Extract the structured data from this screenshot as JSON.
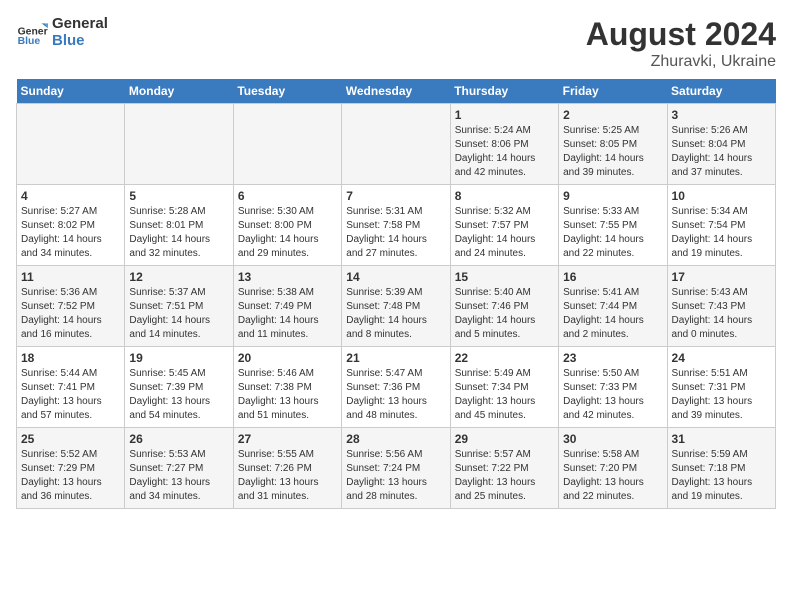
{
  "logo": {
    "general": "General",
    "blue": "Blue"
  },
  "title": "August 2024",
  "subtitle": "Zhuravki, Ukraine",
  "weekdays": [
    "Sunday",
    "Monday",
    "Tuesday",
    "Wednesday",
    "Thursday",
    "Friday",
    "Saturday"
  ],
  "weeks": [
    [
      {
        "day": "",
        "info": ""
      },
      {
        "day": "",
        "info": ""
      },
      {
        "day": "",
        "info": ""
      },
      {
        "day": "",
        "info": ""
      },
      {
        "day": "1",
        "info": "Sunrise: 5:24 AM\nSunset: 8:06 PM\nDaylight: 14 hours\nand 42 minutes."
      },
      {
        "day": "2",
        "info": "Sunrise: 5:25 AM\nSunset: 8:05 PM\nDaylight: 14 hours\nand 39 minutes."
      },
      {
        "day": "3",
        "info": "Sunrise: 5:26 AM\nSunset: 8:04 PM\nDaylight: 14 hours\nand 37 minutes."
      }
    ],
    [
      {
        "day": "4",
        "info": "Sunrise: 5:27 AM\nSunset: 8:02 PM\nDaylight: 14 hours\nand 34 minutes."
      },
      {
        "day": "5",
        "info": "Sunrise: 5:28 AM\nSunset: 8:01 PM\nDaylight: 14 hours\nand 32 minutes."
      },
      {
        "day": "6",
        "info": "Sunrise: 5:30 AM\nSunset: 8:00 PM\nDaylight: 14 hours\nand 29 minutes."
      },
      {
        "day": "7",
        "info": "Sunrise: 5:31 AM\nSunset: 7:58 PM\nDaylight: 14 hours\nand 27 minutes."
      },
      {
        "day": "8",
        "info": "Sunrise: 5:32 AM\nSunset: 7:57 PM\nDaylight: 14 hours\nand 24 minutes."
      },
      {
        "day": "9",
        "info": "Sunrise: 5:33 AM\nSunset: 7:55 PM\nDaylight: 14 hours\nand 22 minutes."
      },
      {
        "day": "10",
        "info": "Sunrise: 5:34 AM\nSunset: 7:54 PM\nDaylight: 14 hours\nand 19 minutes."
      }
    ],
    [
      {
        "day": "11",
        "info": "Sunrise: 5:36 AM\nSunset: 7:52 PM\nDaylight: 14 hours\nand 16 minutes."
      },
      {
        "day": "12",
        "info": "Sunrise: 5:37 AM\nSunset: 7:51 PM\nDaylight: 14 hours\nand 14 minutes."
      },
      {
        "day": "13",
        "info": "Sunrise: 5:38 AM\nSunset: 7:49 PM\nDaylight: 14 hours\nand 11 minutes."
      },
      {
        "day": "14",
        "info": "Sunrise: 5:39 AM\nSunset: 7:48 PM\nDaylight: 14 hours\nand 8 minutes."
      },
      {
        "day": "15",
        "info": "Sunrise: 5:40 AM\nSunset: 7:46 PM\nDaylight: 14 hours\nand 5 minutes."
      },
      {
        "day": "16",
        "info": "Sunrise: 5:41 AM\nSunset: 7:44 PM\nDaylight: 14 hours\nand 2 minutes."
      },
      {
        "day": "17",
        "info": "Sunrise: 5:43 AM\nSunset: 7:43 PM\nDaylight: 14 hours\nand 0 minutes."
      }
    ],
    [
      {
        "day": "18",
        "info": "Sunrise: 5:44 AM\nSunset: 7:41 PM\nDaylight: 13 hours\nand 57 minutes."
      },
      {
        "day": "19",
        "info": "Sunrise: 5:45 AM\nSunset: 7:39 PM\nDaylight: 13 hours\nand 54 minutes."
      },
      {
        "day": "20",
        "info": "Sunrise: 5:46 AM\nSunset: 7:38 PM\nDaylight: 13 hours\nand 51 minutes."
      },
      {
        "day": "21",
        "info": "Sunrise: 5:47 AM\nSunset: 7:36 PM\nDaylight: 13 hours\nand 48 minutes."
      },
      {
        "day": "22",
        "info": "Sunrise: 5:49 AM\nSunset: 7:34 PM\nDaylight: 13 hours\nand 45 minutes."
      },
      {
        "day": "23",
        "info": "Sunrise: 5:50 AM\nSunset: 7:33 PM\nDaylight: 13 hours\nand 42 minutes."
      },
      {
        "day": "24",
        "info": "Sunrise: 5:51 AM\nSunset: 7:31 PM\nDaylight: 13 hours\nand 39 minutes."
      }
    ],
    [
      {
        "day": "25",
        "info": "Sunrise: 5:52 AM\nSunset: 7:29 PM\nDaylight: 13 hours\nand 36 minutes."
      },
      {
        "day": "26",
        "info": "Sunrise: 5:53 AM\nSunset: 7:27 PM\nDaylight: 13 hours\nand 34 minutes."
      },
      {
        "day": "27",
        "info": "Sunrise: 5:55 AM\nSunset: 7:26 PM\nDaylight: 13 hours\nand 31 minutes."
      },
      {
        "day": "28",
        "info": "Sunrise: 5:56 AM\nSunset: 7:24 PM\nDaylight: 13 hours\nand 28 minutes."
      },
      {
        "day": "29",
        "info": "Sunrise: 5:57 AM\nSunset: 7:22 PM\nDaylight: 13 hours\nand 25 minutes."
      },
      {
        "day": "30",
        "info": "Sunrise: 5:58 AM\nSunset: 7:20 PM\nDaylight: 13 hours\nand 22 minutes."
      },
      {
        "day": "31",
        "info": "Sunrise: 5:59 AM\nSunset: 7:18 PM\nDaylight: 13 hours\nand 19 minutes."
      }
    ]
  ]
}
